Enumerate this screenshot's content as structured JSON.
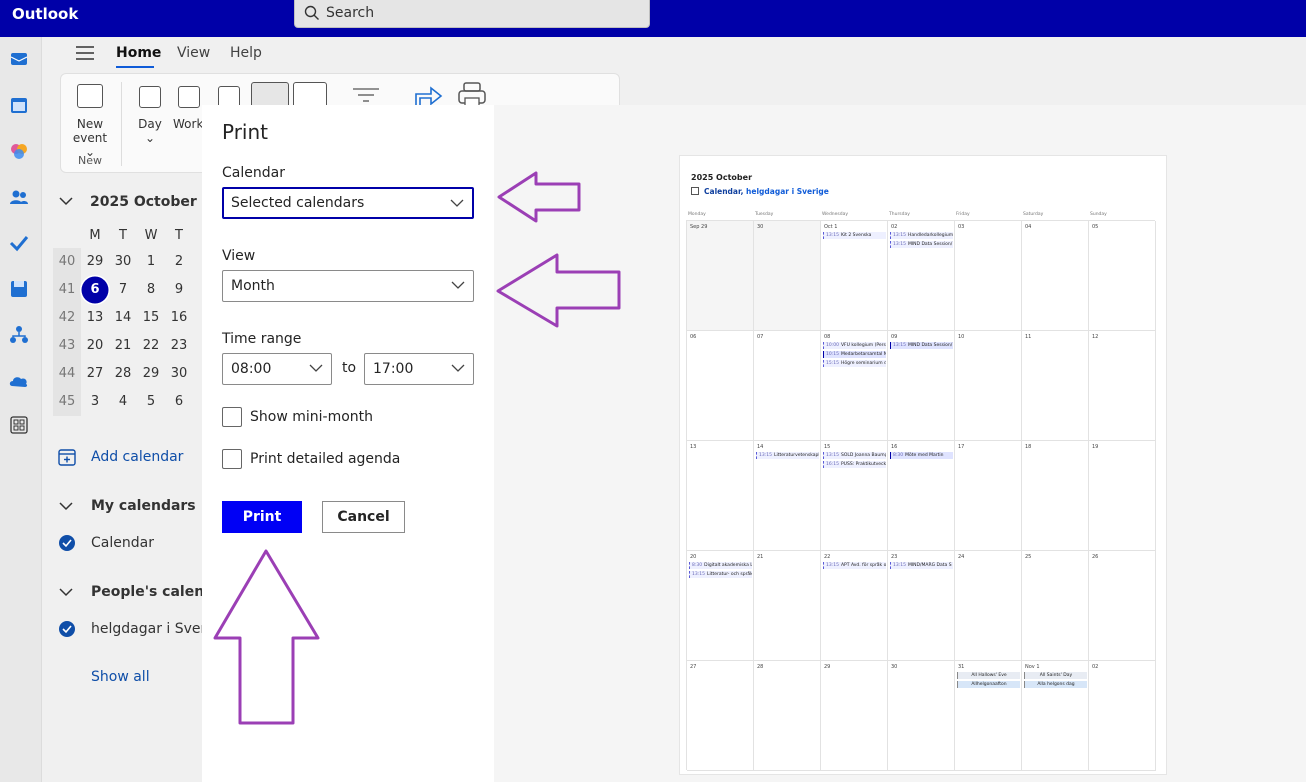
{
  "app": {
    "title": "Outlook"
  },
  "search": {
    "placeholder": "Search"
  },
  "menu": {
    "tabs": [
      {
        "label": "Home"
      },
      {
        "label": "View"
      },
      {
        "label": "Help"
      }
    ]
  },
  "ribbon": {
    "new_event_line1": "New",
    "new_event_line2": "event",
    "group_new": "New",
    "day": "Day",
    "work_week": "Work week"
  },
  "mini_calendar": {
    "title": "2025 October",
    "weekday_headers": [
      "M",
      "T",
      "W",
      "T"
    ],
    "weeks": [
      {
        "wk": "40",
        "days": [
          "29",
          "30",
          "1",
          "2"
        ]
      },
      {
        "wk": "41",
        "days": [
          "6",
          "7",
          "8",
          "9"
        ]
      },
      {
        "wk": "42",
        "days": [
          "13",
          "14",
          "15",
          "16"
        ]
      },
      {
        "wk": "43",
        "days": [
          "20",
          "21",
          "22",
          "23"
        ]
      },
      {
        "wk": "44",
        "days": [
          "27",
          "28",
          "29",
          "30"
        ]
      },
      {
        "wk": "45",
        "days": [
          "3",
          "4",
          "5",
          "6"
        ]
      }
    ],
    "selected": "6"
  },
  "sidebar": {
    "add_calendar": "Add calendar",
    "my_calendars": "My calendars",
    "calendar_item": "Calendar",
    "peoples_calendars": "People's calendars",
    "holiday_item": "helgdagar i Sverige",
    "show_all": "Show all"
  },
  "print_dialog": {
    "title": "Print",
    "calendar_label": "Calendar",
    "calendar_value": "Selected calendars",
    "view_label": "View",
    "view_value": "Month",
    "time_range_label": "Time range",
    "start_time": "08:00",
    "to_label": "to",
    "end_time": "17:00",
    "show_mini_month": "Show mini-month",
    "print_detailed_agenda": "Print detailed agenda",
    "print_button": "Print",
    "cancel_button": "Cancel"
  },
  "preview": {
    "title": "2025 October",
    "calendars_a": "Calendar,",
    "calendars_b": " helgdagar i Sverige",
    "weekdays": [
      "Monday",
      "Tuesday",
      "Wednesday",
      "Thursday",
      "Friday",
      "Saturday",
      "Sunday"
    ],
    "weeks": [
      {
        "days": [
          {
            "n": "Sep 29",
            "out": true,
            "events": []
          },
          {
            "n": "30",
            "out": true,
            "events": []
          },
          {
            "n": "Oct 1",
            "events": [
              {
                "t": "13:15",
                "s": "Kit 2 Svenska",
                "alt": true
              }
            ]
          },
          {
            "n": "02",
            "events": [
              {
                "t": "13:15",
                "s": "Handledarkollegium",
                "alt": true
              },
              {
                "t": "13:15",
                "s": "MIND Data Session/",
                "alt": true
              }
            ]
          },
          {
            "n": "03",
            "events": []
          },
          {
            "n": "04",
            "events": []
          },
          {
            "n": "05",
            "events": []
          }
        ]
      },
      {
        "days": [
          {
            "n": "06",
            "events": []
          },
          {
            "n": "07",
            "events": []
          },
          {
            "n": "08",
            "events": [
              {
                "t": "10:00",
                "s": "VFU kollegium (Pers",
                "alt": true
              },
              {
                "t": "10:15",
                "s": "Medarbetarsamtal N"
              },
              {
                "t": "15:15",
                "s": "Högre seminarium d",
                "alt": true
              }
            ]
          },
          {
            "n": "09",
            "events": [
              {
                "t": "13:15",
                "s": "MIND Data Session/",
                "alt": false
              }
            ]
          },
          {
            "n": "10",
            "events": []
          },
          {
            "n": "11",
            "events": []
          },
          {
            "n": "12",
            "events": []
          }
        ]
      },
      {
        "days": [
          {
            "n": "13",
            "events": []
          },
          {
            "n": "14",
            "events": [
              {
                "t": "13:15",
                "s": "Litteraturvetenskapli",
                "alt": true
              }
            ]
          },
          {
            "n": "15",
            "events": [
              {
                "t": "13:15",
                "s": "SOLD Joanna Baumg",
                "alt": true
              },
              {
                "t": "16:15",
                "s": "PUSS: Praktikutveckl",
                "alt": true
              }
            ]
          },
          {
            "n": "16",
            "events": [
              {
                "t": "8:30",
                "s": "Möte med Martin"
              }
            ]
          },
          {
            "n": "17",
            "events": []
          },
          {
            "n": "18",
            "events": []
          },
          {
            "n": "19",
            "events": []
          }
        ]
      },
      {
        "days": [
          {
            "n": "20",
            "events": [
              {
                "t": "8:30",
                "s": "Digitalt akademiska L",
                "alt": true
              },
              {
                "t": "13:15",
                "s": "Litteratur- och språk",
                "alt": true
              }
            ]
          },
          {
            "n": "21",
            "events": []
          },
          {
            "n": "22",
            "events": [
              {
                "t": "13:15",
                "s": "APT Avd. för språk o",
                "alt": true
              }
            ]
          },
          {
            "n": "23",
            "events": [
              {
                "t": "13:15",
                "s": "MIND/MARG Data S",
                "alt": true
              }
            ]
          },
          {
            "n": "24",
            "events": []
          },
          {
            "n": "25",
            "events": []
          },
          {
            "n": "26",
            "events": []
          }
        ]
      },
      {
        "days": [
          {
            "n": "27",
            "events": []
          },
          {
            "n": "28",
            "events": []
          },
          {
            "n": "29",
            "events": []
          },
          {
            "n": "30",
            "events": []
          },
          {
            "n": "31",
            "events": [
              {
                "s": "All Hallows' Eve",
                "hol": 1
              },
              {
                "s": "Allhelgonaafton",
                "hol": 2
              }
            ]
          },
          {
            "n": "Nov 1",
            "events": [
              {
                "s": "All Saints' Day",
                "hol": 1
              },
              {
                "s": "Alla helgons dag",
                "hol": 2
              }
            ]
          },
          {
            "n": "02",
            "events": []
          }
        ]
      }
    ]
  },
  "colors": {
    "brand": "#0000a8",
    "print_button": "#0000f5",
    "annotation": "#9b3fb5"
  }
}
